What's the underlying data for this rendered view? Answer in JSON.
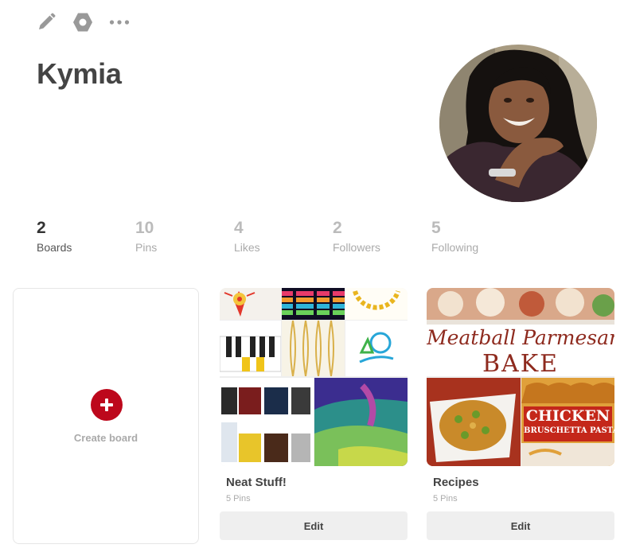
{
  "toolbar": {
    "icons": [
      "pencil-icon",
      "settings-hexagon-icon",
      "more-dots-icon"
    ]
  },
  "profile": {
    "name": "Kymia"
  },
  "stats": [
    {
      "count": "2",
      "label": "Boards"
    },
    {
      "count": "10",
      "label": "Pins"
    },
    {
      "count": "4",
      "label": "Likes"
    },
    {
      "count": "2",
      "label": "Followers"
    },
    {
      "count": "5",
      "label": "Following"
    }
  ],
  "create_board": {
    "label": "Create board"
  },
  "boards": [
    {
      "title": "Neat Stuff!",
      "count": "5 Pins",
      "edit_label": "Edit"
    },
    {
      "title": "Recipes",
      "count": "5 Pins",
      "edit_label": "Edit",
      "cover_text": {
        "main_line1": "Meatball Parmesan",
        "main_line2": "BAKE",
        "side_line1": "CHICKEN",
        "side_line2": "BRUSCHETTA PASTA"
      }
    }
  ],
  "colors": {
    "accent": "#bd081c",
    "recipe_red": "#8e2a1e"
  }
}
